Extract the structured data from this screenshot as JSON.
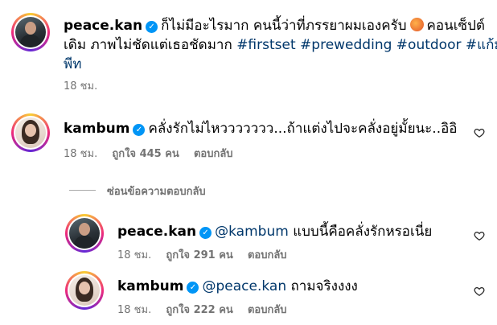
{
  "caption": {
    "username": "peace.kan",
    "text_line1": "ก็ไม่มีอะไรมาก คนนี้ว่าที่ภรรยาผมเองครับ",
    "text_line1b": "คอนเซ็ปต์",
    "text_line2_prefix": "เดิม ภาพไม่ชัดแต่เธอชัดมาก",
    "hashtags": [
      "#firstset",
      "#prewedding",
      "#outdoor",
      "#แก้ม"
    ],
    "text_line3": "พีท",
    "time": "18 ชม."
  },
  "comments": [
    {
      "username": "kambum",
      "text": "คลั่งรักไม่ไหววววววว...ถ้าแต่งไปจะคลั่งอยู่มั้ยนะ..อิอิ",
      "time": "18 ชม.",
      "likes": "ถูกใจ 445 คน",
      "reply": "ตอบกลับ"
    }
  ],
  "hide_replies": "ซ่อนข้อความตอบกลับ",
  "replies": [
    {
      "username": "peace.kan",
      "mention": "@kambum",
      "text": "แบบนี้คือคลั่งรักหรอเนี่ย",
      "time": "18 ชม.",
      "likes": "ถูกใจ 291 คน",
      "reply": "ตอบกลับ"
    },
    {
      "username": "kambum",
      "mention": "@peace.kan",
      "text": "ถามจริงงงง",
      "time": "18 ชม.",
      "likes": "ถูกใจ 222 คน",
      "reply": "ตอบกลับ"
    }
  ],
  "icons": {
    "verified": "verified-badge-icon",
    "heart": "heart-outline-icon",
    "emoji": "emoji-icon"
  },
  "colors": {
    "hashtag": "#00376b",
    "verified": "#0095f6",
    "meta": "#737373"
  }
}
